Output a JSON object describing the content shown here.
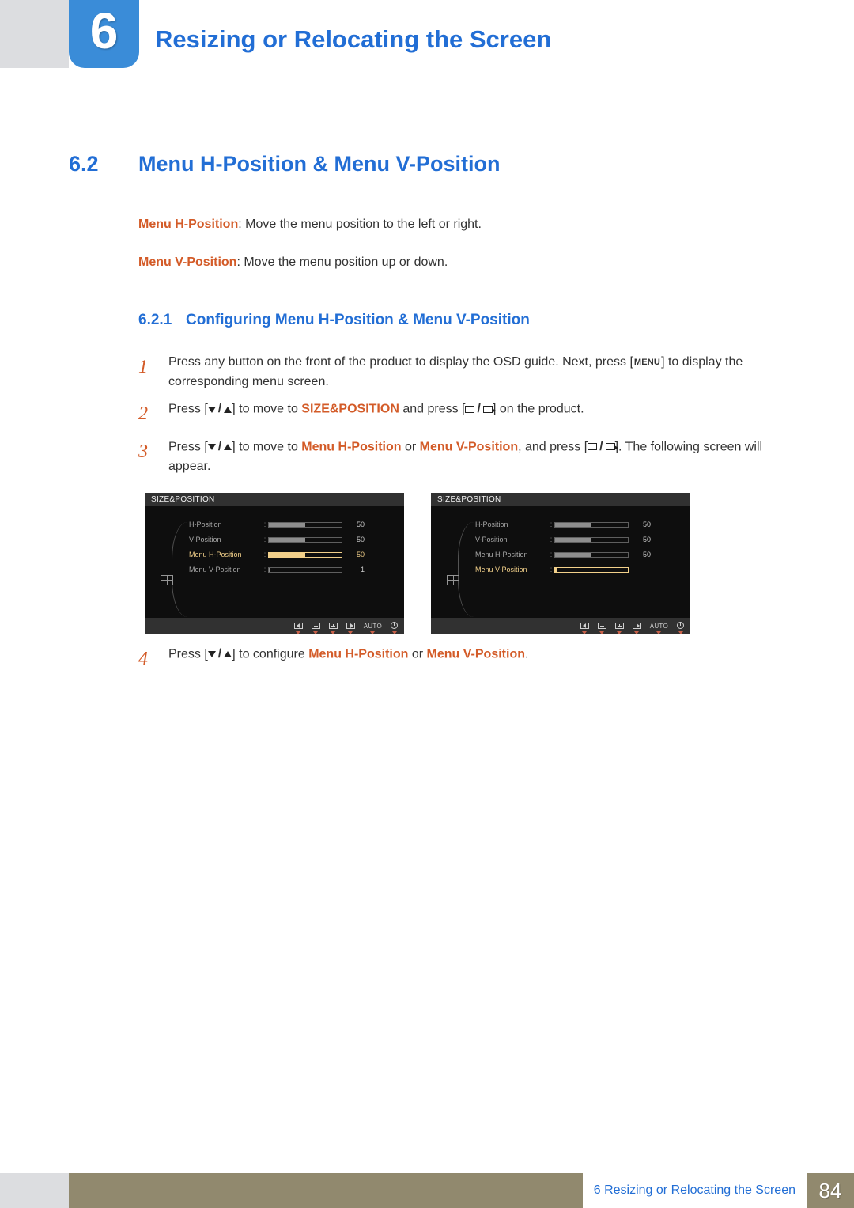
{
  "chapter": {
    "number": "6",
    "title": "Resizing or Relocating the Screen"
  },
  "section": {
    "number": "6.2",
    "title": "Menu H-Position & Menu V-Position"
  },
  "descriptions": {
    "h": {
      "label": "Menu H-Position",
      "text": ": Move the menu position to the left or right."
    },
    "v": {
      "label": "Menu V-Position",
      "text": ": Move the menu position up or down."
    }
  },
  "subsection": {
    "number": "6.2.1",
    "title": "Configuring Menu H-Position & Menu V-Position"
  },
  "steps": {
    "s1": {
      "n": "1",
      "pre": "Press any button on the front of the product to display the OSD guide. Next, press [",
      "menu": "MENU",
      "post": "] to display the corresponding menu screen."
    },
    "s2": {
      "n": "2",
      "pre": "Press [",
      "mid1": "] to move to ",
      "target": "SIZE&POSITION",
      "mid2": " and press [",
      "post": "] on the product."
    },
    "s3": {
      "n": "3",
      "pre": "Press [",
      "mid1": "] to move to ",
      "t1": "Menu H-Position",
      "or": " or ",
      "t2": "Menu V-Position",
      "mid2": ", and press [",
      "post": "]. The following screen will appear."
    },
    "s4": {
      "n": "4",
      "pre": "Press [",
      "mid1": "] to configure ",
      "t1": "Menu H-Position",
      "or": " or ",
      "t2": "Menu V-Position",
      "post": "."
    }
  },
  "osd_left": {
    "title": "SIZE&POSITION",
    "rows": [
      {
        "label": "H-Position",
        "value": "50",
        "fill": 50,
        "active": false
      },
      {
        "label": "V-Position",
        "value": "50",
        "fill": 50,
        "active": false
      },
      {
        "label": "Menu H-Position",
        "value": "50",
        "fill": 50,
        "active": true
      },
      {
        "label": "Menu V-Position",
        "value": "1",
        "fill": 2,
        "active": false
      }
    ],
    "footer_auto": "AUTO"
  },
  "osd_right": {
    "title": "SIZE&POSITION",
    "rows": [
      {
        "label": "H-Position",
        "value": "50",
        "fill": 50,
        "active": false
      },
      {
        "label": "V-Position",
        "value": "50",
        "fill": 50,
        "active": false
      },
      {
        "label": "Menu H-Position",
        "value": "50",
        "fill": 50,
        "active": false
      },
      {
        "label": "Menu V-Position",
        "value": "",
        "fill": 2,
        "active": true
      }
    ],
    "footer_auto": "AUTO"
  },
  "footer": {
    "label": "6 Resizing or Relocating the Screen",
    "page": "84"
  }
}
